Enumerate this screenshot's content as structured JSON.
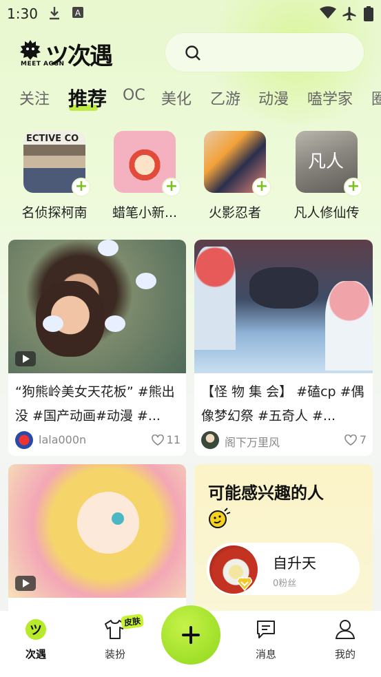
{
  "status_bar": {
    "time": "1:30"
  },
  "header": {
    "logo_text": "次遇",
    "logo_sub": "MEET ACGN"
  },
  "tabs": [
    {
      "label": "关注"
    },
    {
      "label": "推荐"
    },
    {
      "label": "OC"
    },
    {
      "label": "美化"
    },
    {
      "label": "乙游"
    },
    {
      "label": "动漫"
    },
    {
      "label": "嗑学家"
    },
    {
      "label": "圈"
    }
  ],
  "topics": [
    {
      "name": "名侦探柯南"
    },
    {
      "name": "蜡笔小新..."
    },
    {
      "name": "火影忍者"
    },
    {
      "name": "凡人修仙传"
    }
  ],
  "posts": [
    {
      "text": "“狗熊岭美女天花板” #熊出没 #国产动画#动漫 #...",
      "author": "lala000n",
      "likes": "11"
    },
    {
      "text": "【怪 物 集 会】 #磕cp #偶像梦幻祭 #五奇人 #...",
      "author": "阁下万里风",
      "likes": "7"
    }
  ],
  "recommend": {
    "title": "可能感兴趣的人",
    "user_name": "自升天",
    "user_fans": "0粉丝"
  },
  "bottom_nav": {
    "items": [
      {
        "label": "次遇"
      },
      {
        "label": "装扮"
      },
      {
        "label": "消息"
      },
      {
        "label": "我的"
      }
    ],
    "badge": "皮肤"
  }
}
